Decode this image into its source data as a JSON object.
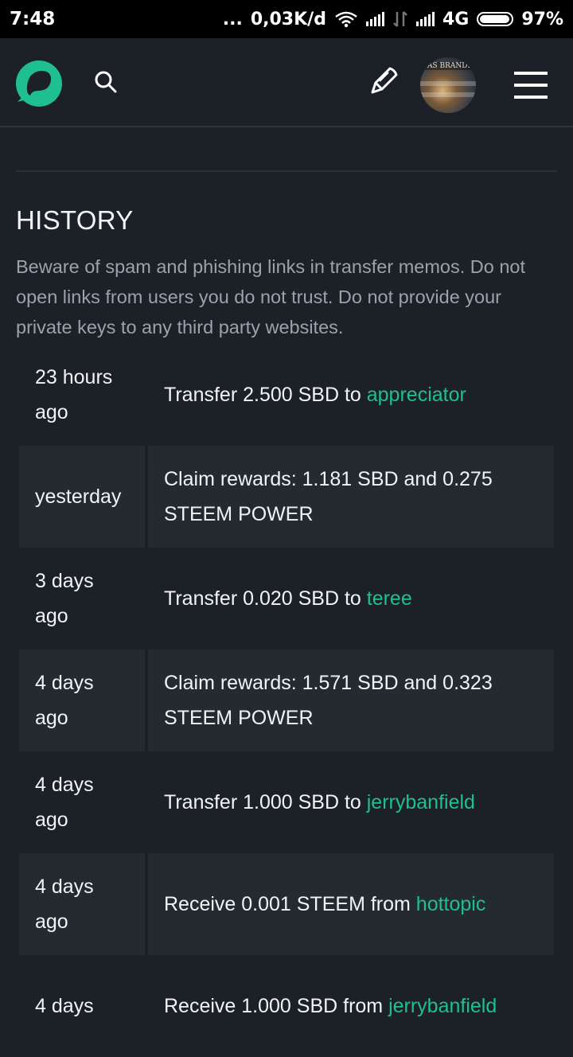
{
  "status_bar": {
    "time": "7:48",
    "dots": "...",
    "net_speed": "0,03K/d",
    "network": "4G",
    "battery": "97%"
  },
  "header": {
    "logo_icon": "steemit-logo-icon",
    "search_icon": "search-icon",
    "pen_icon": "pen-icon",
    "avatar_text": "AS BRANDE",
    "menu_icon": "hamburger-menu-icon",
    "accent_color": "#1fbf8f"
  },
  "history": {
    "title": "HISTORY",
    "warning": "Beware of spam and phishing links in transfer memos. Do not open links from users you do not trust. Do not provide your private keys to any third party websites.",
    "rows": [
      {
        "time_line1": "23 hours",
        "time_line2": "ago",
        "text": "Transfer 2.500 SBD to ",
        "link": "appreciator"
      },
      {
        "time_line1": "yesterday",
        "time_line2": "",
        "text": "Claim rewards: 1.181 SBD and 0.275 STEEM POWER",
        "link": ""
      },
      {
        "time_line1": "3 days",
        "time_line2": "ago",
        "text": "Transfer 0.020 SBD to ",
        "link": "teree"
      },
      {
        "time_line1": "4 days",
        "time_line2": "ago",
        "text": "Claim rewards: 1.571 SBD and 0.323 STEEM POWER",
        "link": ""
      },
      {
        "time_line1": "4 days",
        "time_line2": "ago",
        "text": "Transfer 1.000 SBD to ",
        "link": "jerrybanfield"
      },
      {
        "time_line1": "4 days",
        "time_line2": "ago",
        "text": "Receive 0.001 STEEM from ",
        "link": "hottopic"
      },
      {
        "time_line1": "4 days",
        "time_line2": "",
        "text": "Receive 1.000 SBD from ",
        "link": "jerrybanfield"
      }
    ]
  }
}
